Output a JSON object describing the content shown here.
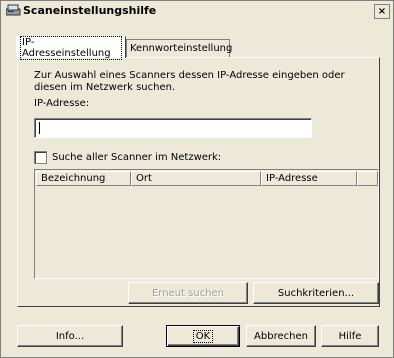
{
  "window": {
    "title": "Scaneinstellungshilfe",
    "close_label": "×"
  },
  "tabs": [
    {
      "label": "IP-Adresseinstellung",
      "active": true
    },
    {
      "label": "Kennworteinstellung",
      "active": false
    }
  ],
  "panel": {
    "instruction": "Zur Auswahl eines Scanners dessen IP-Adresse eingeben oder diesen im Netzwerk suchen.",
    "ip_label": "IP-Adresse:",
    "ip_value": "",
    "search_all_label": "Suche aller Scanner im Netzwerk:",
    "search_all_checked": false,
    "list_columns": [
      "Bezeichnung",
      "Ort",
      "IP-Adresse",
      ""
    ],
    "rows": [],
    "retry_search_label": "Erneut suchen",
    "search_criteria_label": "Suchkriterien..."
  },
  "footer": {
    "info_label": "Info...",
    "ok_label": "OK",
    "cancel_label": "Abbrechen",
    "help_label": "Hilfe"
  },
  "colors": {
    "face": "#ece9d8",
    "window_bg": "#ffffff",
    "disabled_text": "#a0a0a0"
  }
}
